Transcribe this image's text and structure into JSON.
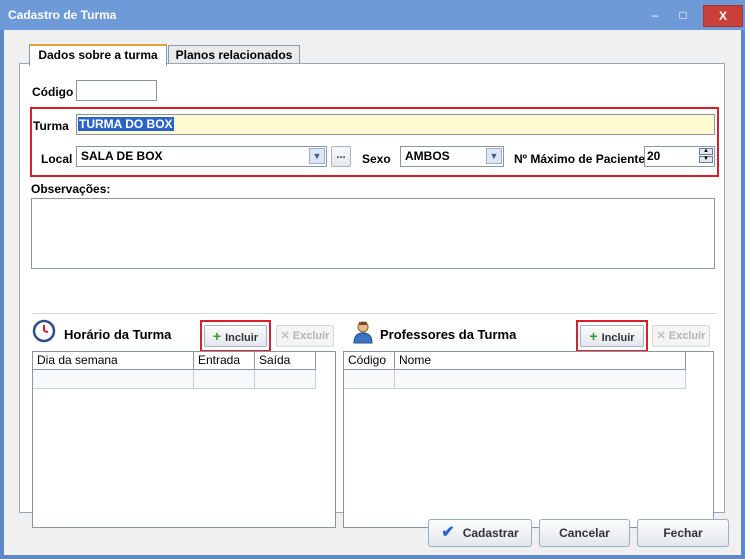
{
  "window": {
    "title": "Cadastro de Turma",
    "minimize": "–",
    "maximize": "□",
    "close": "X"
  },
  "tabs": [
    {
      "label": "Dados sobre a turma"
    },
    {
      "label": "Planos relacionados"
    }
  ],
  "form": {
    "codigo_label": "Código",
    "codigo_value": "",
    "turma_label": "Turma",
    "turma_value": "TURMA DO BOX",
    "local_label": "Local",
    "local_value": "SALA DE BOX",
    "local_browse": "...",
    "sexo_label": "Sexo",
    "sexo_value": "AMBOS",
    "max_label": "Nº Máximo de Paciente",
    "max_value": "20",
    "obs_label": "Observações:",
    "obs_value": ""
  },
  "horario": {
    "title": "Horário da Turma",
    "incluir": "Incluir",
    "excluir": "Excluir",
    "columns": [
      "Dia da semana",
      "Entrada",
      "Saída"
    ]
  },
  "professores": {
    "title": "Professores da Turma",
    "incluir": "Incluir",
    "excluir": "Excluir",
    "columns": [
      "Código",
      "Nome"
    ]
  },
  "footer": {
    "cadastrar": "Cadastrar",
    "cancelar": "Cancelar",
    "fechar": "Fechar"
  },
  "colors": {
    "title_bar": "#6e9ad8",
    "highlight": "#d6202b",
    "accent_tab": "#e6a23a",
    "turma_bg": "#fffbd0"
  }
}
